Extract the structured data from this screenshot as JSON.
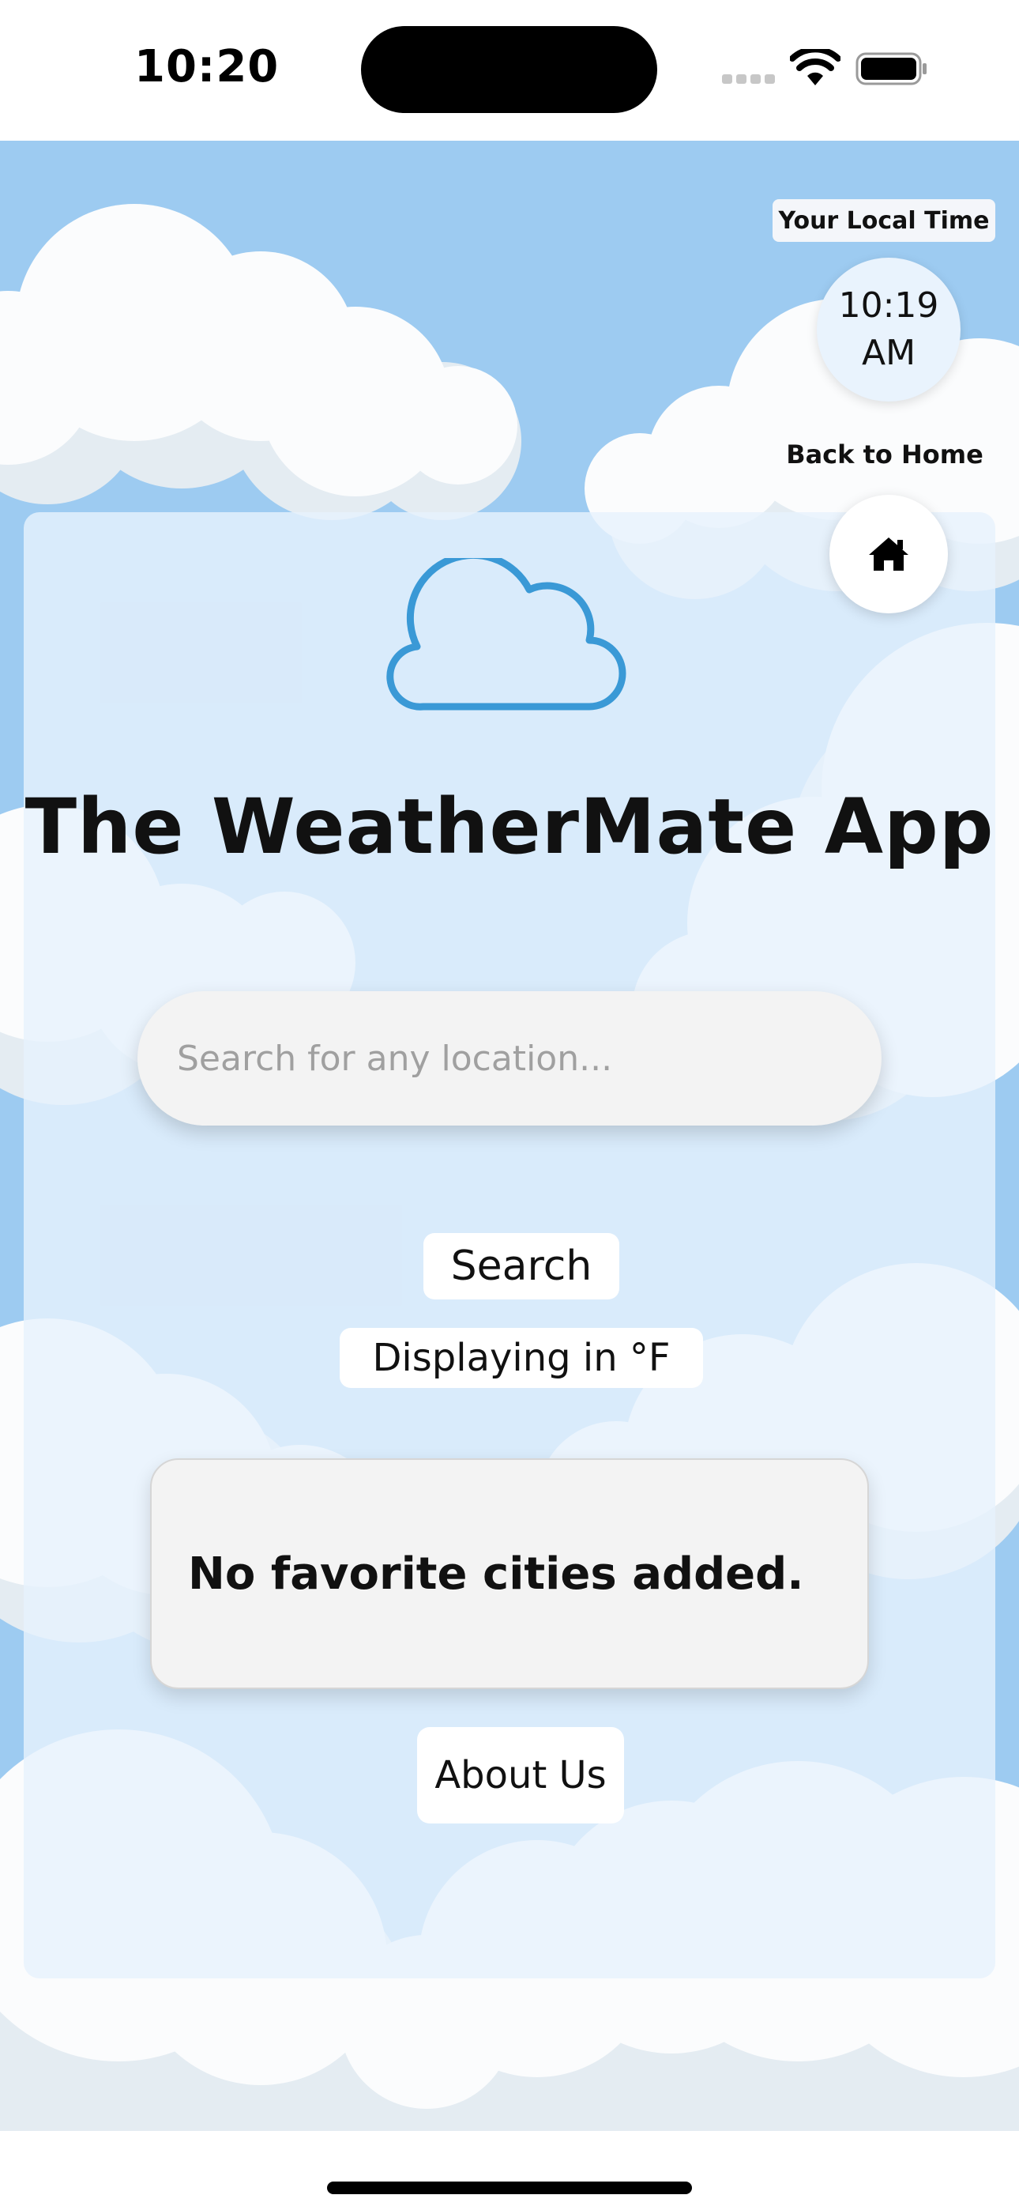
{
  "status_bar": {
    "time": "10:20"
  },
  "local_time": {
    "label": "Your Local Time",
    "time": "10:19",
    "period": "AM"
  },
  "home_nav": {
    "label": "Back to Home",
    "icon": "home-icon"
  },
  "app": {
    "title": "The WeatherMate App",
    "logo_icon": "cloud-outline-icon",
    "accent_color": "#3a99d6",
    "sky_color": "#9dcbf1"
  },
  "search": {
    "placeholder": "Search for any location...",
    "value": "",
    "button_label": "Search"
  },
  "units": {
    "label": "Displaying in °F"
  },
  "favorites": {
    "empty_message": "No favorite cities added."
  },
  "footer": {
    "about_label": "About Us"
  }
}
